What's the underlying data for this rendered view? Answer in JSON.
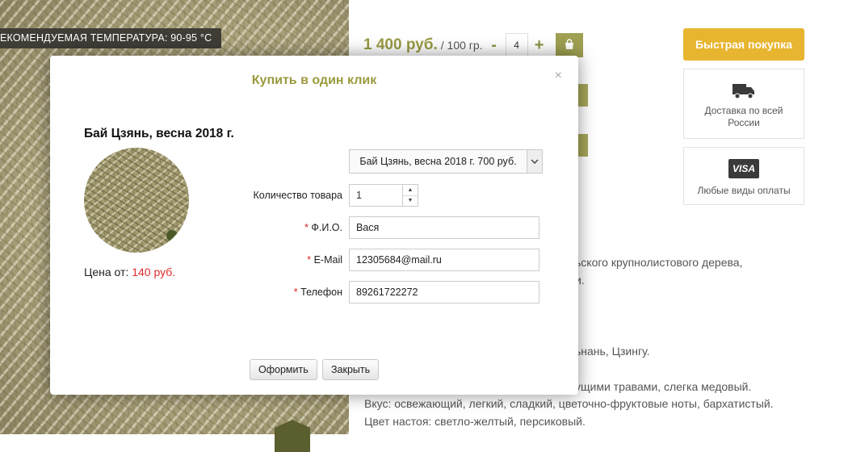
{
  "background": {
    "temperature_banner": "ЕКОМЕНДУЕМАЯ ТЕМПЕРАТУРА: 90-95 °C",
    "price": "1 400 руб.",
    "price_per": "/ 100 гр.",
    "qty_minus": "-",
    "qty_value": "4",
    "qty_plus": "+",
    "quick_buy": "Быстрая покупка",
    "delivery": "Доставка по всей России",
    "payment": "Любые виды оплаты",
    "payment_card": "VISA",
    "desc_lines": [
      "ьского крупнолистового дерева,",
      "и.",
      "ьнань, Цзингу.",
      "ущими травами, слегка медовый.",
      "Вкус: освежающий, легкий, сладкий, цветочно-фруктовые ноты, бархатистый.",
      "Цвет настоя: светло-желтый, персиковый."
    ]
  },
  "modal": {
    "title": "Купить в один клик",
    "close": "×",
    "product_name": "Бай Цзянь, весна 2018 г.",
    "price_label": "Цена от:",
    "price_value": "140 руб.",
    "variant": "Бай Цзянь, весна 2018 г. 700 руб.",
    "qty_label": "Количество товара",
    "qty_value": "1",
    "name_label": "Ф.И.О.",
    "name_value": "Вася",
    "email_label": "E-Mail",
    "email_value": "12305684@mail.ru",
    "phone_label": "Телефон",
    "phone_value": "89261722272",
    "required_mark": "*",
    "submit": "Оформить",
    "close_button": "Закрыть"
  },
  "colors": {
    "accent_olive": "#9b9b3f",
    "quick_buy": "#e7b52f",
    "price_red": "#e02c2c"
  }
}
